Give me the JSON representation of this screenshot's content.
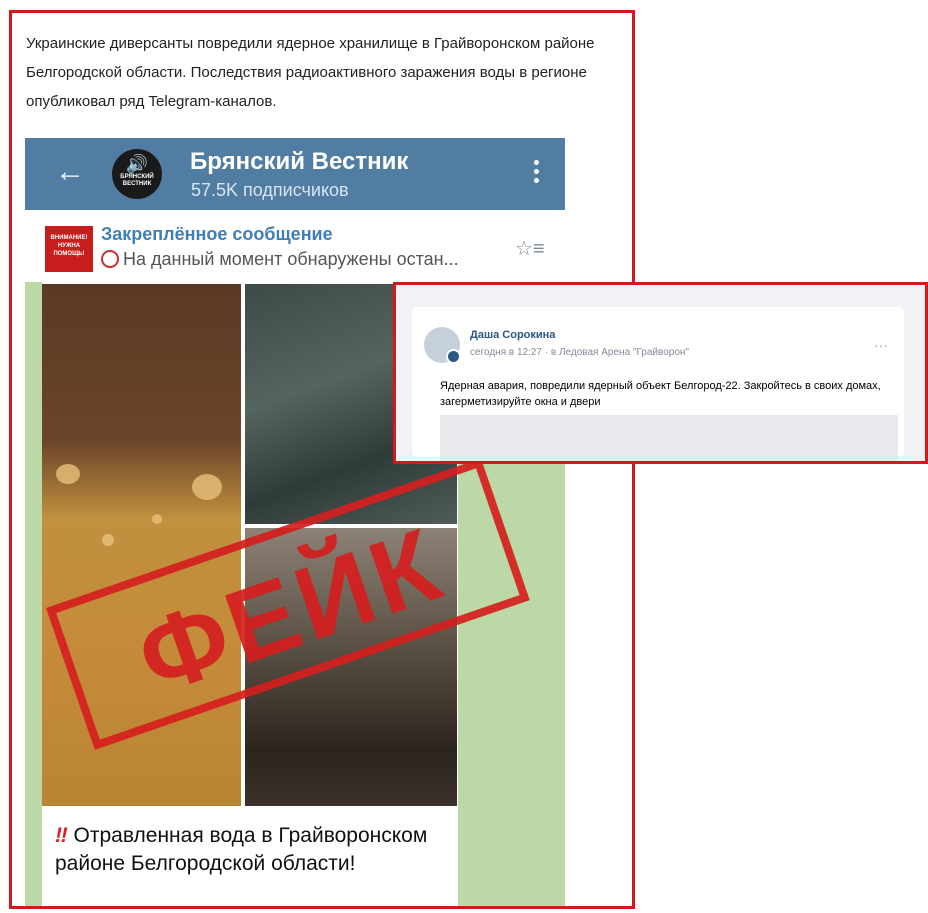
{
  "article": {
    "lead": "Украинские диверсанты повредили ядерное хранилище в Грайворонском районе Белгородской области. Последствия радиоактивного заражения воды в регионе опубликовал ряд Telegram-каналов."
  },
  "telegram": {
    "back_icon": "arrow-left-icon",
    "channel_title": "Брянский Вестник",
    "subscribers": "57.5K подписчиков",
    "avatar_text": "БРЯНСКИЙ ВЕСТНИК",
    "pinned_title": "Закреплённое сообщение",
    "pinned_text": "На данный момент обнаружены остан...",
    "pinned_thumb_text": "ВНИМАНИЕ! НУЖНА ПОМОЩЬ!",
    "message_emoji": "‼",
    "message_text": "Отравленная вода в Грайворонском районе Белгородской области!",
    "header_color": "#517da2"
  },
  "stamp": {
    "text": "ФЕЙК",
    "color": "#d51f1f"
  },
  "vk_post": {
    "author": "Даша Сорокина",
    "time": "сегодня в 12:27",
    "separator": "·",
    "location": "в Ледовая Арена \"Грайворон\"",
    "text": "Ядерная авария, повредили ядерный объект Белгород-22. Закройтесь в своих домах, загерметизируйте окна и двери",
    "menu": "···"
  }
}
